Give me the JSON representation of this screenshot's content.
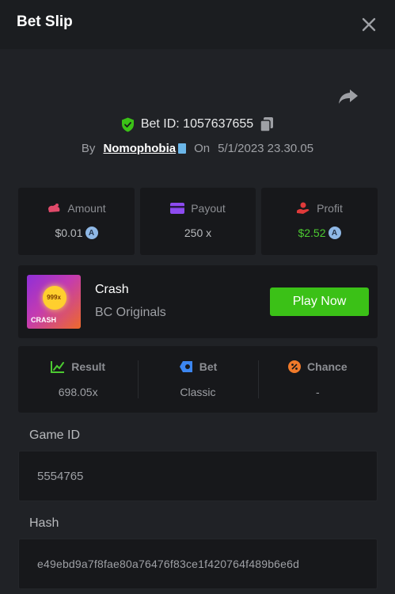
{
  "header": {
    "title": "Bet Slip"
  },
  "bet": {
    "id_label": "Bet ID: 1057637655",
    "by_label": "By",
    "username": "Nomophobia",
    "on_label": "On",
    "timestamp": "5/1/2023 23.30.05"
  },
  "stats": {
    "amount": {
      "label": "Amount",
      "value": "$0.01"
    },
    "payout": {
      "label": "Payout",
      "value": "250 x"
    },
    "profit": {
      "label": "Profit",
      "value": "$2.52"
    }
  },
  "game": {
    "name": "Crash",
    "provider": "BC Originals",
    "play_label": "Play Now",
    "thumb_multiplier": "999x",
    "thumb_label": "CRASH"
  },
  "result": {
    "result": {
      "label": "Result",
      "value": "698.05x"
    },
    "bet": {
      "label": "Bet",
      "value": "Classic"
    },
    "chance": {
      "label": "Chance",
      "value": "-"
    }
  },
  "fields": {
    "game_id_label": "Game ID",
    "game_id_value": "5554765",
    "hash_label": "Hash",
    "hash_value": "e49ebd9a7f8fae80a76476f83ce1f420764f489b6e6d"
  },
  "colors": {
    "accent_green": "#3bc117",
    "profit_green": "#4ccb31",
    "amount_icon": "#e04a6a",
    "payout_icon": "#8d4bf0",
    "profit_icon": "#e03a3a",
    "result_icon": "#4ccb31",
    "bet_icon": "#3c86f0",
    "chance_icon": "#f07a2a"
  },
  "icons": [
    "close-icon",
    "share-icon",
    "shield-check-icon",
    "copy-icon",
    "verified-badge-icon",
    "coin-icon",
    "wallet-icon",
    "card-icon",
    "hand-coin-icon",
    "chart-icon",
    "chip-icon",
    "percent-icon"
  ]
}
